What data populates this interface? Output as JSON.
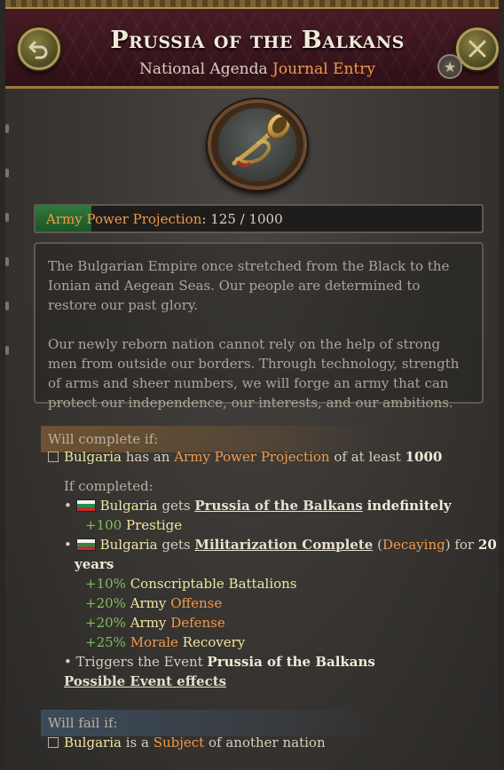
{
  "header": {
    "title": "Prussia of the Balkans",
    "subtitle_prefix": "National Agenda",
    "subtitle_accent": "Journal Entry"
  },
  "icons": {
    "back": "undo-arrow-icon",
    "close": "close-icon",
    "favorite": "star-icon",
    "emblem": "bugle-horn-icon"
  },
  "progress": {
    "label": "Army Power Projection",
    "colon": ":",
    "value_text": "125 / 1000",
    "fraction": 0.125
  },
  "description": {
    "p1": "The Bulgarian Empire once stretched from the Black to the Ionian and Aegean Seas. Our people are determined to restore our past glory.",
    "p2": "Our newly reborn nation cannot rely on the help of strong men from outside our borders. Through technology, strength of arms and sheer numbers, we will forge an army that can protect our independence, our interests, and our ambitions."
  },
  "complete": {
    "heading": "Will complete if:",
    "cond_country": "Bulgaria",
    "cond_mid": "has an",
    "cond_metric": "Army Power Projection",
    "cond_mid2": "of at least",
    "cond_value": "1000",
    "if_completed": "If completed:",
    "e1_country": "Bulgaria",
    "e1_gets": "gets",
    "e1_modifier": "Prussia of the Balkans",
    "e1_duration": "indefinitely",
    "e1_effect_value": "+100",
    "e1_effect_name": "Prestige",
    "e2_country": "Bulgaria",
    "e2_gets": "gets",
    "e2_modifier": "Militarization Complete",
    "e2_decay": "Decaying",
    "e2_for": "for",
    "e2_years_num": "20",
    "e2_years_word": "years",
    "effects": [
      {
        "value": "+10%",
        "pre": "Conscriptable Battalions",
        "accent": ""
      },
      {
        "value": "+20%",
        "pre": "Army",
        "accent": "Offense"
      },
      {
        "value": "+20%",
        "pre": "Army",
        "accent": "Defense"
      },
      {
        "value": "+25%",
        "pre": "",
        "accent": "Morale",
        "post": "Recovery"
      }
    ],
    "trigger_pre": "• Triggers the Event",
    "trigger_event": "Prussia of the Balkans",
    "possible_effects": "Possible Event effects"
  },
  "fail": {
    "heading": "Will fail if:",
    "country": "Bulgaria",
    "mid": "is a",
    "accent": "Subject",
    "post": "of another nation"
  },
  "colors": {
    "accent_orange": "#f09a4a",
    "positive_green": "#7fc05a",
    "progress_fill": "#2f7a3a",
    "header_red": "#4a1c26"
  }
}
